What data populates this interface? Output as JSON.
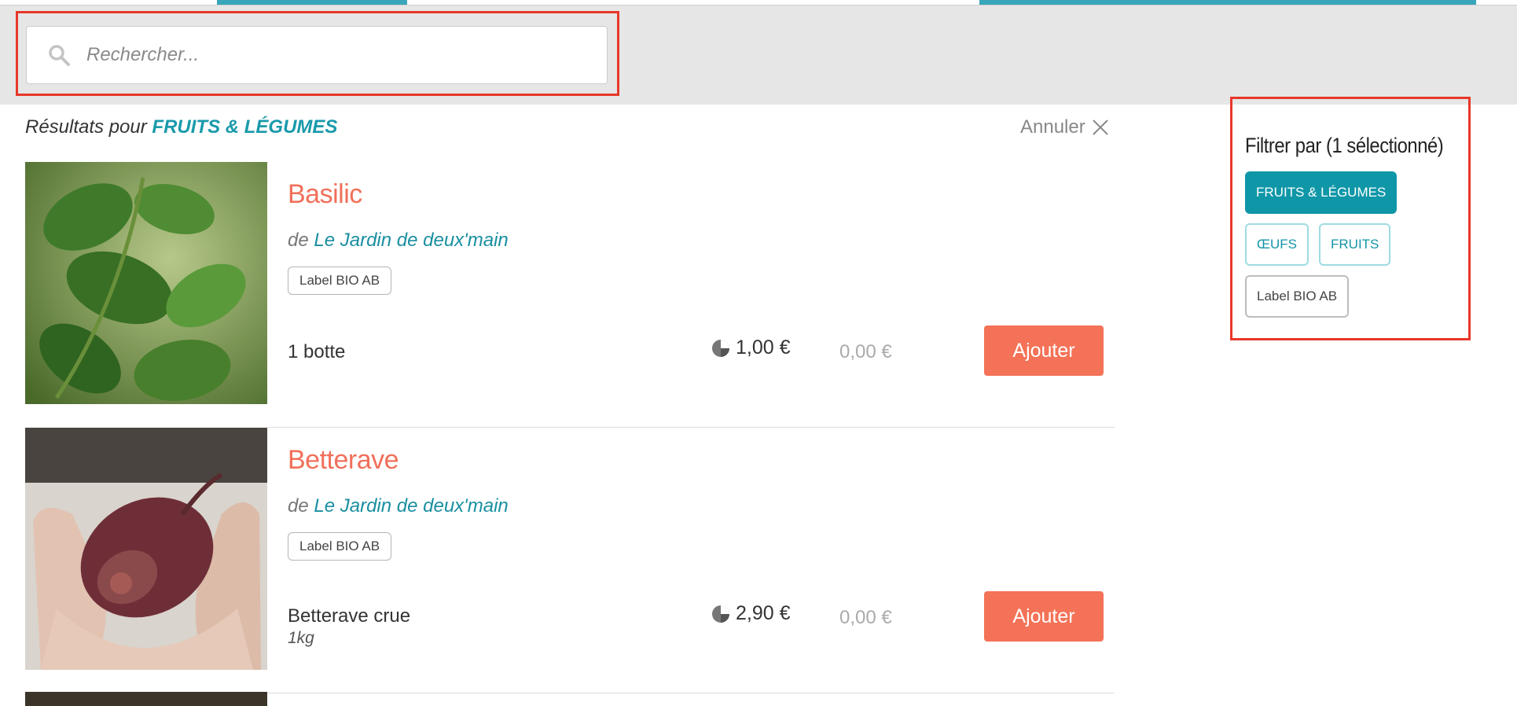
{
  "search": {
    "placeholder": "Rechercher..."
  },
  "results": {
    "prefix": "Résultats pour",
    "category": "FRUITS & LÉGUMES",
    "cancel_label": "Annuler"
  },
  "products": [
    {
      "name": "Basilic",
      "by": "de",
      "producer": "Le Jardin de deux'main",
      "tag": "Label BIO AB",
      "unit": "1 botte",
      "unit_detail": "",
      "price": "1,00 €",
      "total": "0,00 €",
      "add_label": "Ajouter"
    },
    {
      "name": "Betterave",
      "by": "de",
      "producer": "Le Jardin de deux'main",
      "tag": "Label BIO AB",
      "unit": "Betterave crue",
      "unit_detail": "1kg",
      "price": "2,90 €",
      "total": "0,00 €",
      "add_label": "Ajouter"
    }
  ],
  "filter": {
    "title": "Filtrer par (1 sélectionné)",
    "chips": [
      {
        "label": "FRUITS & LÉGUMES",
        "selected": true
      },
      {
        "label": "ŒUFS",
        "selected": false
      },
      {
        "label": "FRUITS",
        "selected": false
      },
      {
        "label": "Label BIO AB",
        "selected": false
      }
    ]
  },
  "colors": {
    "accent": "#0f97a8",
    "product_name": "#f0705a",
    "add_button": "#f47257",
    "highlight": "#e8372a"
  },
  "icons": {
    "search": "search-icon",
    "cancel": "close-icon",
    "price": "pie-chart-icon"
  }
}
